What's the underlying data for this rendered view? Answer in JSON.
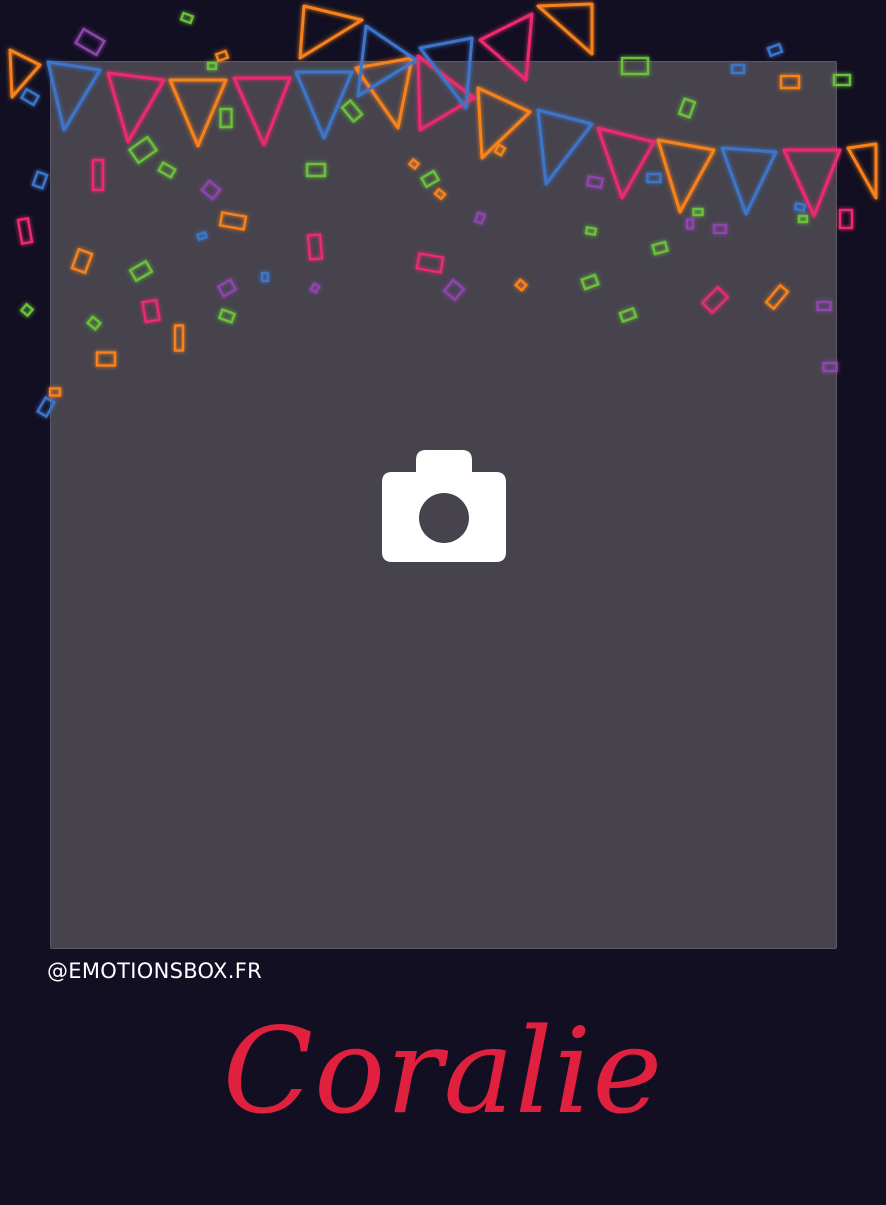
{
  "handle": "@EMOTIONSBOX.FR",
  "name": "Coralie",
  "icons": {
    "camera": "camera-icon"
  },
  "colors": {
    "background": "#120f22",
    "photo_placeholder": "#46434d",
    "name_text": "#e0203f",
    "handle_text": "#ffffff",
    "neon_orange": "#f7821b",
    "neon_pink": "#ec2b6e",
    "neon_blue": "#3d74c8",
    "neon_purple": "#8e44ad",
    "neon_green": "#6abf3a"
  }
}
